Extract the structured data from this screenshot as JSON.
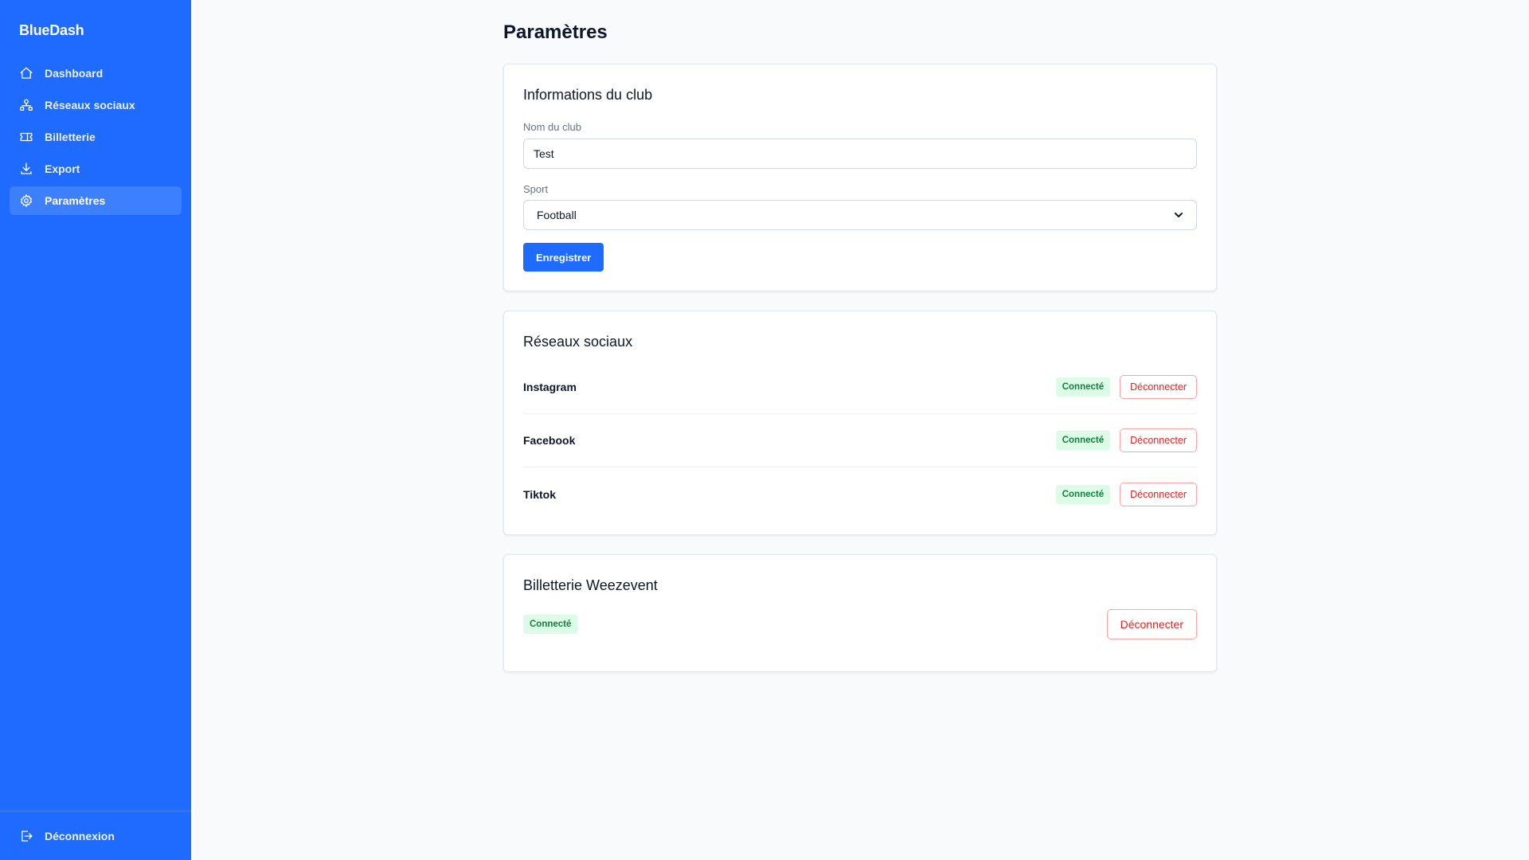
{
  "app": {
    "brand": "BlueDash"
  },
  "sidebar": {
    "items": [
      {
        "label": "Dashboard",
        "icon": "home-icon"
      },
      {
        "label": "Réseaux sociaux",
        "icon": "social-network-icon"
      },
      {
        "label": "Billetterie",
        "icon": "ticket-icon"
      },
      {
        "label": "Export",
        "icon": "download-icon"
      },
      {
        "label": "Paramètres",
        "icon": "gear-icon",
        "active": true
      }
    ],
    "logout_label": "Déconnexion"
  },
  "page": {
    "title": "Paramètres"
  },
  "club_card": {
    "title": "Informations du club",
    "name_label": "Nom du club",
    "name_value": "Test",
    "sport_label": "Sport",
    "sport_value": "Football",
    "save_label": "Enregistrer"
  },
  "social_card": {
    "title": "Réseaux sociaux",
    "rows": [
      {
        "name": "Instagram",
        "status": "Connecté",
        "action": "Déconnecter"
      },
      {
        "name": "Facebook",
        "status": "Connecté",
        "action": "Déconnecter"
      },
      {
        "name": "Tiktok",
        "status": "Connecté",
        "action": "Déconnecter"
      }
    ]
  },
  "weezevent_card": {
    "title": "Billetterie Weezevent",
    "status": "Connecté",
    "action": "Déconnecter"
  },
  "colors": {
    "sidebar": "#1f6bff",
    "primary": "#1f6bff",
    "success_bg": "#dcfce7",
    "success_text": "#15803d",
    "danger": "#dc2626"
  }
}
